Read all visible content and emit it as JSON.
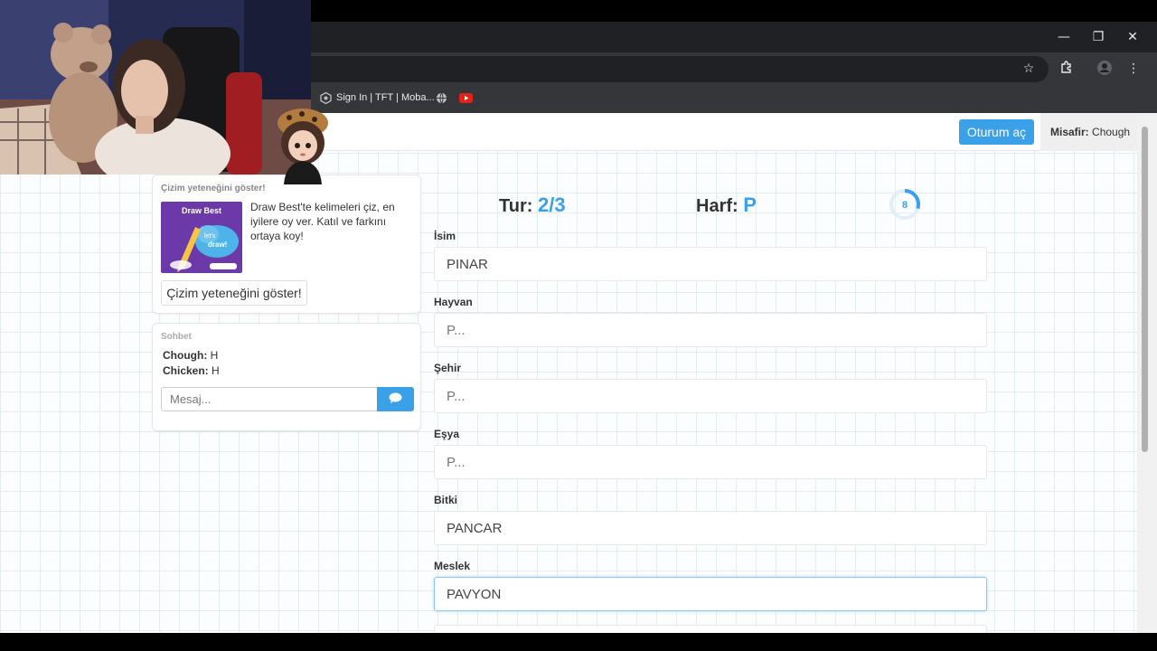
{
  "bookmarks": [
    {
      "label": "Sign In | TFT | Moba...",
      "icon": "tft-icon"
    },
    {
      "label": "",
      "icon": "globe-icon"
    },
    {
      "label": "",
      "icon": "youtube-icon"
    }
  ],
  "header": {
    "login_label": "Oturum aç",
    "guest_prefix": "Misafir:",
    "guest_name": "Chough"
  },
  "promo": {
    "title": "Çizim yeteneğini göster!",
    "image_label": "Draw Best",
    "text": "Draw Best'te kelimeleri çiz, en iyilere oy ver. Katıl ve farkını ortaya koy!",
    "button_label": "Çizim yeteneğini göster!"
  },
  "chat": {
    "title": "Sohbet",
    "messages": [
      {
        "user": "Chough:",
        "text": "H"
      },
      {
        "user": "Chicken:",
        "text": "H"
      }
    ],
    "input_placeholder": "Mesaj..."
  },
  "game": {
    "round_label": "Tur:",
    "round_value": "2/3",
    "letter_label": "Harf:",
    "letter_value": "P",
    "timer_value": "8",
    "timer_fraction": 0.3,
    "fields": [
      {
        "label": "İsim",
        "value": "PINAR",
        "placeholder": "P..."
      },
      {
        "label": "Hayvan",
        "value": "",
        "placeholder": "P..."
      },
      {
        "label": "Şehir",
        "value": "",
        "placeholder": "P..."
      },
      {
        "label": "Eşya",
        "value": "",
        "placeholder": "P..."
      },
      {
        "label": "Bitki",
        "value": "PANCAR",
        "placeholder": "P..."
      },
      {
        "label": "Meslek",
        "value": "PAVYON",
        "placeholder": "P..."
      }
    ]
  },
  "colors": {
    "accent": "#3aa0e8",
    "chrome_dark": "#202124",
    "chrome_toolbar": "#35363a"
  }
}
